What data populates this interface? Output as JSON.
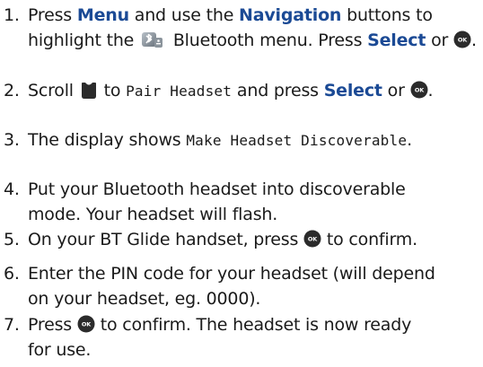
{
  "steps": [
    {
      "num": "1.",
      "t1": "Press ",
      "k1": "Menu",
      "t2": " and use the ",
      "k2": "Navigation",
      "t3": " buttons to highlight the ",
      "icon1": "bluetooth-menu-icon",
      "t4": " Bluetooth menu. Press ",
      "k3": "Select",
      "t5": " or ",
      "icon2": "ok-button-icon",
      "t6": "."
    },
    {
      "num": "2.",
      "t1": "Scroll ",
      "icon1": "scroll-down-icon",
      "t2": " to ",
      "lcd": "Pair Headset",
      "t3": " and press ",
      "k1": "Select",
      "t4": " or ",
      "icon2": "ok-button-icon",
      "t5": "."
    },
    {
      "num": "3.",
      "t1": "The display shows ",
      "lcd": "Make Headset Discoverable",
      "t2": "."
    },
    {
      "num": "4.",
      "text": "Put your Bluetooth headset into discoverable mode. Your headset will flash."
    },
    {
      "num": "5.",
      "t1": "On your BT Glide handset, press ",
      "icon1": "ok-button-icon",
      "t2": " to confirm."
    },
    {
      "num": "6.",
      "text": "Enter the PIN code for your headset (will depend on your headset, eg. 0000)."
    },
    {
      "num": "7.",
      "t1": "Press ",
      "icon1": "ok-button-icon",
      "t2": " to confirm. The headset is now ready for use."
    }
  ],
  "colors": {
    "keyword": "#1b4a95",
    "text": "#1a1a1a",
    "ok_button": "#2b2b2b"
  }
}
